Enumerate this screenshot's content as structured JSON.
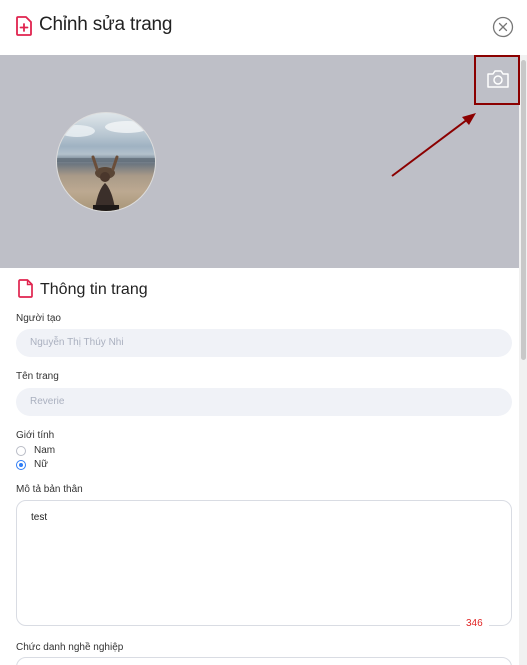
{
  "header": {
    "title": "Chỉnh sửa trang",
    "icon": "page-plus-icon",
    "close_icon": "close-circle-icon"
  },
  "cover": {
    "camera_icon": "camera-icon",
    "annotation": "arrow-pointing-to-camera"
  },
  "section": {
    "title": "Thông tin trang",
    "icon": "page-icon"
  },
  "fields": {
    "creator": {
      "label": "Người tạo",
      "value": "Nguyễn Thị Thúy Nhi"
    },
    "page_name": {
      "label": "Tên trang",
      "value": "Reverie"
    },
    "gender": {
      "label": "Giới tính",
      "options": [
        "Nam",
        "Nữ"
      ],
      "selected": "Nữ"
    },
    "description": {
      "label": "Mô tả bản thân",
      "value": "test",
      "remaining": "346"
    },
    "job_title": {
      "label": "Chức danh nghề nghiệp"
    }
  },
  "colors": {
    "accent": "#e0234e",
    "cover_bg": "#bebfc7",
    "annotation": "#8b0000",
    "radio_selected": "#2f7df6",
    "counter": "#e02424"
  }
}
